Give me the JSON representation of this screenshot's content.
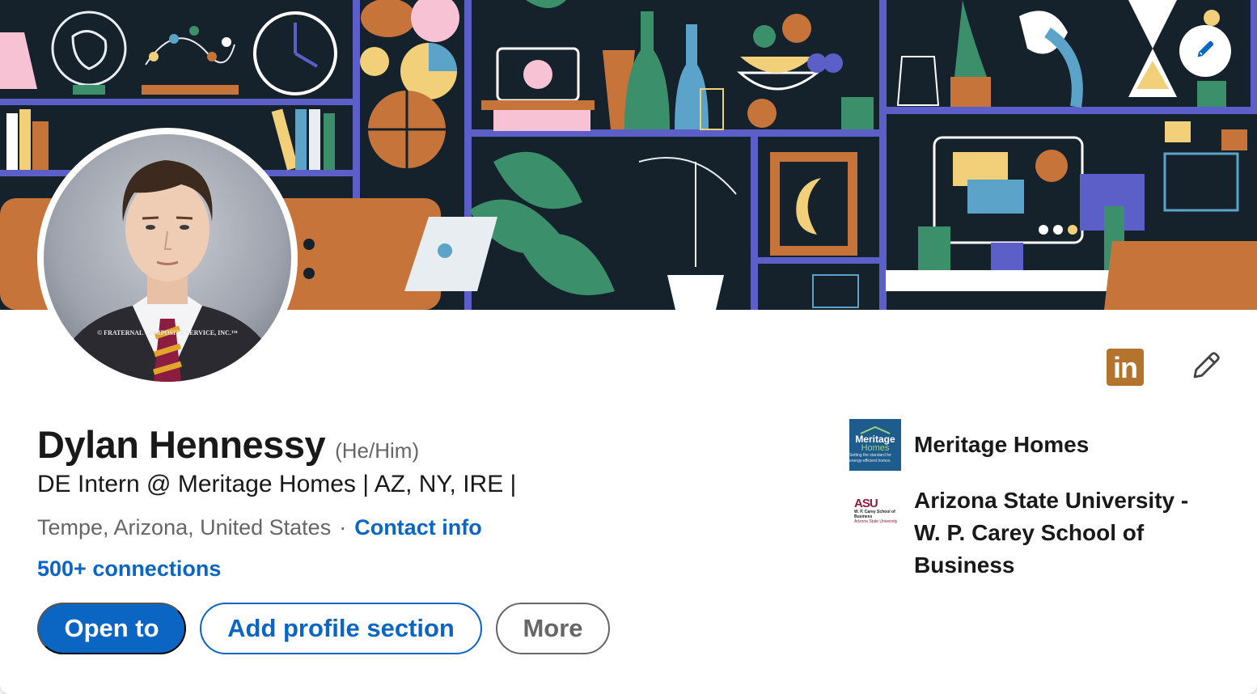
{
  "profile": {
    "name": "Dylan Hennessy",
    "pronouns": "(He/Him)",
    "headline": "DE Intern @ Meritage Homes | AZ, NY, IRE |",
    "location": "Tempe, Arizona, United States",
    "separator": "·",
    "contact_info_label": "Contact info",
    "connections": "500+ connections",
    "photo_watermark": "© FRATERNAL COMPOSITE SERVICE, INC.™"
  },
  "actions": {
    "open_to_label": "Open to",
    "add_section_label": "Add profile section",
    "more_label": "More"
  },
  "icons": {
    "edit_banner": "pencil-icon",
    "linkedin_badge": "linkedin-icon",
    "edit_profile": "pencil-icon",
    "linkedin_text": "in"
  },
  "experience": {
    "company": "Meritage Homes",
    "company_logo": {
      "line1": "Meritage",
      "line2": "Homes",
      "tagline": "Setting the standard for energy-efficient homes"
    },
    "education": "Arizona State University - W. P. Carey School of Business",
    "education_logo": {
      "line1": "ASU",
      "line2": "W. P. Carey School of Business",
      "line3": "Arizona State University"
    }
  },
  "colors": {
    "brand_blue": "#0a66c2",
    "banner_bg": "#15212b",
    "linkedin_badge": "#b5742e",
    "shelf_purple": "#5b5fc7"
  }
}
